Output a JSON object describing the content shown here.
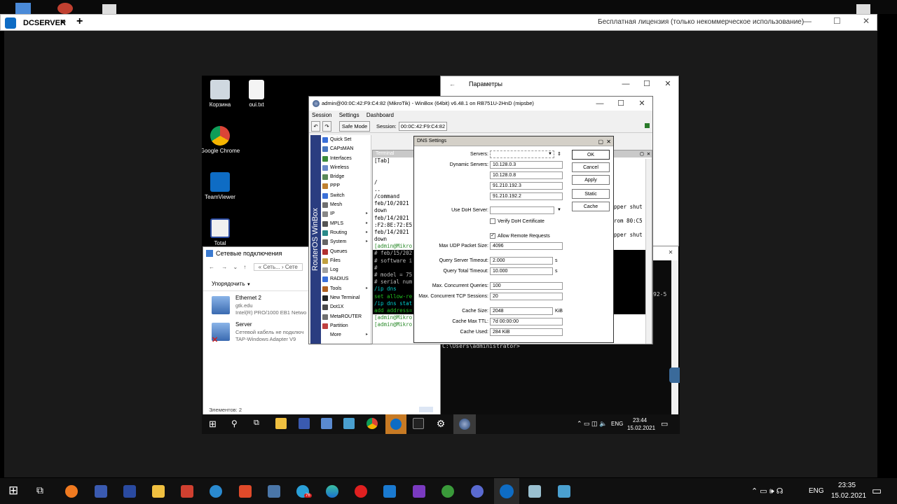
{
  "teamviewer": {
    "tab_label": "DCSERVER",
    "license_text": "Бесплатная лицензия (только некоммерческое использование)"
  },
  "remote_desktop": {
    "icons": [
      {
        "label": "Корзина"
      },
      {
        "label": "oui.txt"
      },
      {
        "label": "Google Chrome"
      },
      {
        "label": "TeamViewer"
      },
      {
        "label": "Total"
      }
    ]
  },
  "settings_window": {
    "title": "Параметры"
  },
  "winbox": {
    "title": "admin@00:0C:42:F9:C4:82 (MikroTik) - WinBox (64bit) v6.48.1 on RB751U-2HnD (mipsbe)",
    "menu": [
      "Session",
      "Settings",
      "Dashboard"
    ],
    "safe_mode_label": "Safe Mode",
    "session_label": "Session:",
    "session_value": "00:0C:42:F9:C4:82",
    "sidebar_label": "RouterOS WinBox",
    "menu_items": [
      {
        "label": "Quick Set",
        "color": "#3a6fd8",
        "arrow": false
      },
      {
        "label": "CAPsMAN",
        "color": "#4a78c0",
        "arrow": false
      },
      {
        "label": "Interfaces",
        "color": "#3c8c3c",
        "arrow": false
      },
      {
        "label": "Wireless",
        "color": "#6a8ac8",
        "arrow": false
      },
      {
        "label": "Bridge",
        "color": "#5a8a5a",
        "arrow": false
      },
      {
        "label": "PPP",
        "color": "#c08030",
        "arrow": false
      },
      {
        "label": "Switch",
        "color": "#3a6fd8",
        "arrow": false
      },
      {
        "label": "Mesh",
        "color": "#707070",
        "arrow": false
      },
      {
        "label": "IP",
        "color": "#888888",
        "arrow": true
      },
      {
        "label": "MPLS",
        "color": "#555555",
        "arrow": true
      },
      {
        "label": "Routing",
        "color": "#2a8a8a",
        "arrow": true
      },
      {
        "label": "System",
        "color": "#666666",
        "arrow": true
      },
      {
        "label": "Queues",
        "color": "#b03030",
        "arrow": false
      },
      {
        "label": "Files",
        "color": "#c0a040",
        "arrow": false
      },
      {
        "label": "Log",
        "color": "#a0a0a0",
        "arrow": false
      },
      {
        "label": "RADIUS",
        "color": "#3a6fd8",
        "arrow": false
      },
      {
        "label": "Tools",
        "color": "#b06020",
        "arrow": true
      },
      {
        "label": "New Terminal",
        "color": "#222222",
        "arrow": false
      },
      {
        "label": "Dot1X",
        "color": "#4a4a4a",
        "arrow": false
      },
      {
        "label": "MetaROUTER",
        "color": "#707070",
        "arrow": false
      },
      {
        "label": "Partition",
        "color": "#c04040",
        "arrow": false
      },
      {
        "label": "More",
        "color": "#ffffff",
        "arrow": true
      }
    ]
  },
  "terminal": {
    "title": "Terminal",
    "lines": [
      "[Tab]",
      "",
      "",
      "/",
      "..",
      "/command",
      "feb/10/2021 ",
      "down",
      "feb/14/2021 ",
      ":F2:8E:72:E5",
      "feb/14/2021 ",
      "down"
    ],
    "hl_lines": [
      {
        "text": "[admin@Mikro",
        "bg": "#ffffff",
        "fg": "#2a8a2a"
      },
      {
        "text": "# feb/15/202",
        "bg": "#000000",
        "fg": "#bbbbbb"
      },
      {
        "text": "# software i",
        "bg": "#000000",
        "fg": "#bbbbbb"
      },
      {
        "text": "#",
        "bg": "#000000",
        "fg": "#bbbbbb"
      },
      {
        "text": "# model = 75",
        "bg": "#000000",
        "fg": "#bbbbbb"
      },
      {
        "text": "# serial num",
        "bg": "#000000",
        "fg": "#bbbbbb"
      },
      {
        "text": "/ip dns",
        "bg": "#000000",
        "fg": "#00d0d0"
      },
      {
        "text": "set allow-re",
        "bg": "#000000",
        "fg": "#20c020"
      },
      {
        "text": "/ip dns stat",
        "bg": "#000000",
        "fg": "#00d0d0"
      },
      {
        "text": "add address=",
        "bg": "#000000",
        "fg": "#20c020"
      },
      {
        "text": "[admin@Mikro",
        "bg": "#ffffff",
        "fg": "#2a8a2a"
      },
      {
        "text": "[admin@Mikro",
        "bg": "#ffffff",
        "fg": "#2a8a2a"
      }
    ],
    "right_fragments": [
      "pper shut",
      "rom 80:C5",
      "pper shut"
    ]
  },
  "dns": {
    "title": "DNS Settings",
    "servers_label": "Servers:",
    "servers_value": "",
    "dynamic_label": "Dynamic Servers:",
    "dynamic_servers": [
      "10.128.0.3",
      "10.128.0.8",
      "91.210.192.3",
      "91.210.192.2"
    ],
    "doh_label": "Use DoH Server:",
    "doh_value": "",
    "verify_doh_label": "Verify DoH Certificate",
    "verify_doh_checked": false,
    "allow_remote_label": "Allow Remote Requests",
    "allow_remote_checked": true,
    "udp_label": "Max UDP Packet Size:",
    "udp_value": "4096",
    "qst_label": "Query Server Timeout:",
    "qst_value": "2.000",
    "qtt_label": "Query Total Timeout:",
    "qtt_value": "10.000",
    "unit_s": "s",
    "mcq_label": "Max. Concurrent Queries:",
    "mcq_value": "100",
    "mctcp_label": "Max. Concurrent TCP Sessions:",
    "mctcp_value": "20",
    "cache_size_label": "Cache Size:",
    "cache_size_value": "2048",
    "unit_kib": "KiB",
    "cache_ttl_label": "Cache Max TTL:",
    "cache_ttl_value": "7d 00:00:00",
    "cache_used_label": "Cache Used:",
    "cache_used_value": "284 KiB",
    "buttons": {
      "ok": "OK",
      "cancel": "Cancel",
      "apply": "Apply",
      "static": "Static",
      "cache": "Cache"
    }
  },
  "netcon": {
    "title": "Сетевые подключения",
    "breadcrumb": "« Сеть... › Сете",
    "organize": "Упорядочить",
    "adapters": [
      {
        "name": "Ethernet 2",
        "line2": "gtk.edu",
        "line3": "Intel(R) PRO/1000 EB1 Netwo"
      },
      {
        "name": "Server",
        "line2": "Сетевой кабель не подключ",
        "line3": "TAP-Windows Adapter V9"
      }
    ],
    "status": "Элементов: 2"
  },
  "cmd": {
    "prompt": "C:\\Users\\administrator>",
    "fragment": "92-5"
  },
  "remote_taskbar": {
    "lang": "ENG",
    "time": "23:44",
    "date": "15.02.2021"
  },
  "host_taskbar": {
    "lang": "ENG",
    "time": "23:35",
    "date": "15.02.2021",
    "telegram_badge": "76"
  }
}
